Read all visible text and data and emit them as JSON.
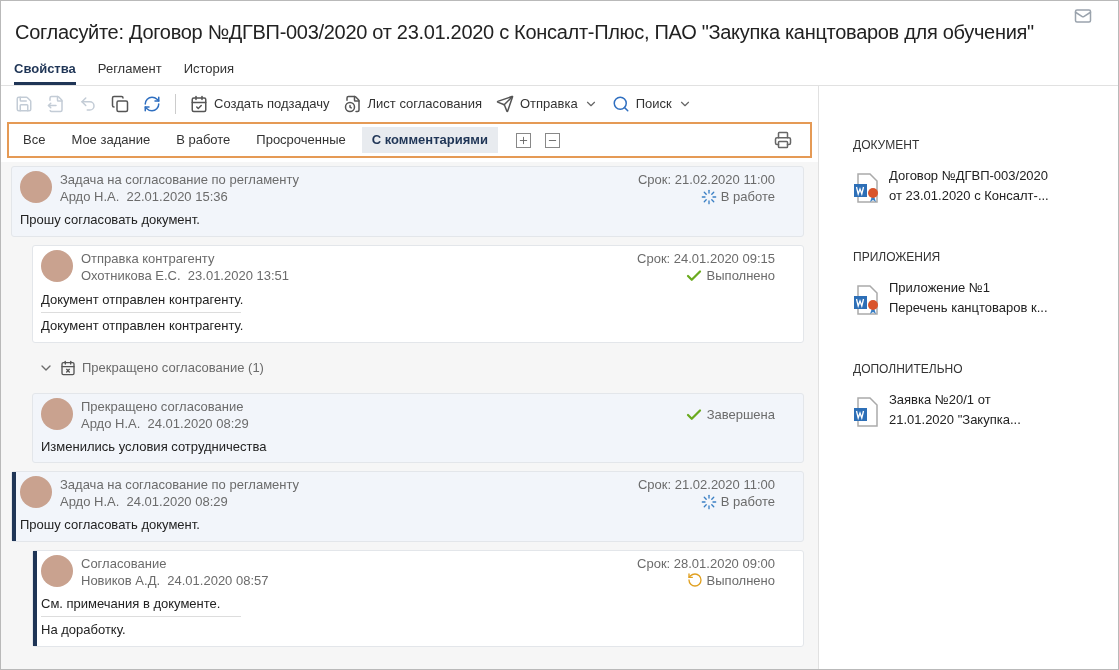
{
  "window": {
    "title": "Согласуйте: Договор №ДГВП-003/2020 от 23.01.2020 с Консалт-Плюс, ПАО \"Закупка канцтоваров для обучения\""
  },
  "tabs": [
    {
      "label": "Свойства",
      "selected": true
    },
    {
      "label": "Регламент",
      "selected": false
    },
    {
      "label": "История",
      "selected": false
    }
  ],
  "toolbar": [
    {
      "kind": "save",
      "disabled": true
    },
    {
      "kind": "export",
      "disabled": true
    },
    {
      "kind": "undo",
      "disabled": true
    },
    {
      "kind": "copy",
      "disabled": false
    },
    {
      "kind": "refresh",
      "disabled": false
    },
    {
      "kind": "subtask",
      "label": "Создать подзадачу",
      "disabled": false
    },
    {
      "kind": "sheet",
      "label": "Лист согласования",
      "disabled": false
    },
    {
      "kind": "send",
      "label": "Отправка",
      "dropdown": true,
      "disabled": false
    },
    {
      "kind": "search",
      "label": "Поиск",
      "dropdown": true,
      "disabled": false
    }
  ],
  "filters": [
    {
      "label": "Все",
      "selected": false
    },
    {
      "label": "Мое задание",
      "selected": false
    },
    {
      "label": "В работе",
      "selected": false
    },
    {
      "label": "Просроченные",
      "selected": false
    },
    {
      "label": "С комментариями",
      "selected": true
    }
  ],
  "tasks": [
    {
      "kind": "task",
      "title": "Задача на согласование по регламенту",
      "author": "Ардо Н.А.",
      "date": "22.01.2020 15:36",
      "deadline": "Срок: 21.02.2020 11:00",
      "status": {
        "kind": "in_progress",
        "text": "В работе"
      },
      "highlighted": true,
      "selected": false,
      "comments": [
        "Прошу согласовать документ."
      ],
      "children": [
        {
          "kind": "task",
          "title": "Отправка контрагенту",
          "author": "Охотникова Е.С.",
          "date": "23.01.2020 13:51",
          "deadline": "Срок: 24.01.2020 09:15",
          "status": {
            "kind": "done",
            "text": "Выполнено"
          },
          "highlighted": false,
          "selected": false,
          "comments": [
            "Документ отправлен контрагенту.",
            "Документ отправлен контрагенту."
          ]
        },
        {
          "kind": "group",
          "label": "Прекращено согласование (1)",
          "expanded": true,
          "children": [
            {
              "kind": "task",
              "title": "Прекращено согласование",
              "author": "Ардо Н.А.",
              "date": "24.01.2020 08:29",
              "status": {
                "kind": "done",
                "text": "Завершена"
              },
              "highlighted": true,
              "selected": false,
              "comments": [
                "Изменились условия сотрудничества"
              ]
            }
          ]
        }
      ]
    },
    {
      "kind": "task",
      "title": "Задача на согласование по регламенту",
      "author": "Ардо Н.А.",
      "date": "24.01.2020 08:29",
      "deadline": "Срок: 21.02.2020 11:00",
      "status": {
        "kind": "in_progress",
        "text": "В работе"
      },
      "highlighted": true,
      "selected": true,
      "comments": [
        "Прошу согласовать документ."
      ],
      "children": [
        {
          "kind": "task",
          "title": "Согласование",
          "author": "Новиков А.Д.",
          "date": "24.01.2020 08:57",
          "deadline": "Срок: 28.01.2020 09:00",
          "status": {
            "kind": "returned",
            "text": "Выполнено"
          },
          "highlighted": false,
          "selected": true,
          "comments": [
            "См. примечания в документе.",
            "На доработку."
          ]
        }
      ]
    }
  ],
  "sidebar": [
    {
      "heading": "ДОКУМЕНТ",
      "items": [
        {
          "lines": [
            "Договор №ДГВП-003/2020",
            "от 23.01.2020 с Консалт-..."
          ],
          "signed": true
        }
      ]
    },
    {
      "heading": "ПРИЛОЖЕНИЯ",
      "items": [
        {
          "lines": [
            "Приложение №1",
            "Перечень канцтоваров к..."
          ],
          "signed": true
        }
      ]
    },
    {
      "heading": "ДОПОЛНИТЕЛЬНО",
      "items": [
        {
          "lines": [
            "Заявка №20/1 от",
            "21.01.2020 \"Закупка..."
          ],
          "signed": false
        }
      ]
    }
  ]
}
